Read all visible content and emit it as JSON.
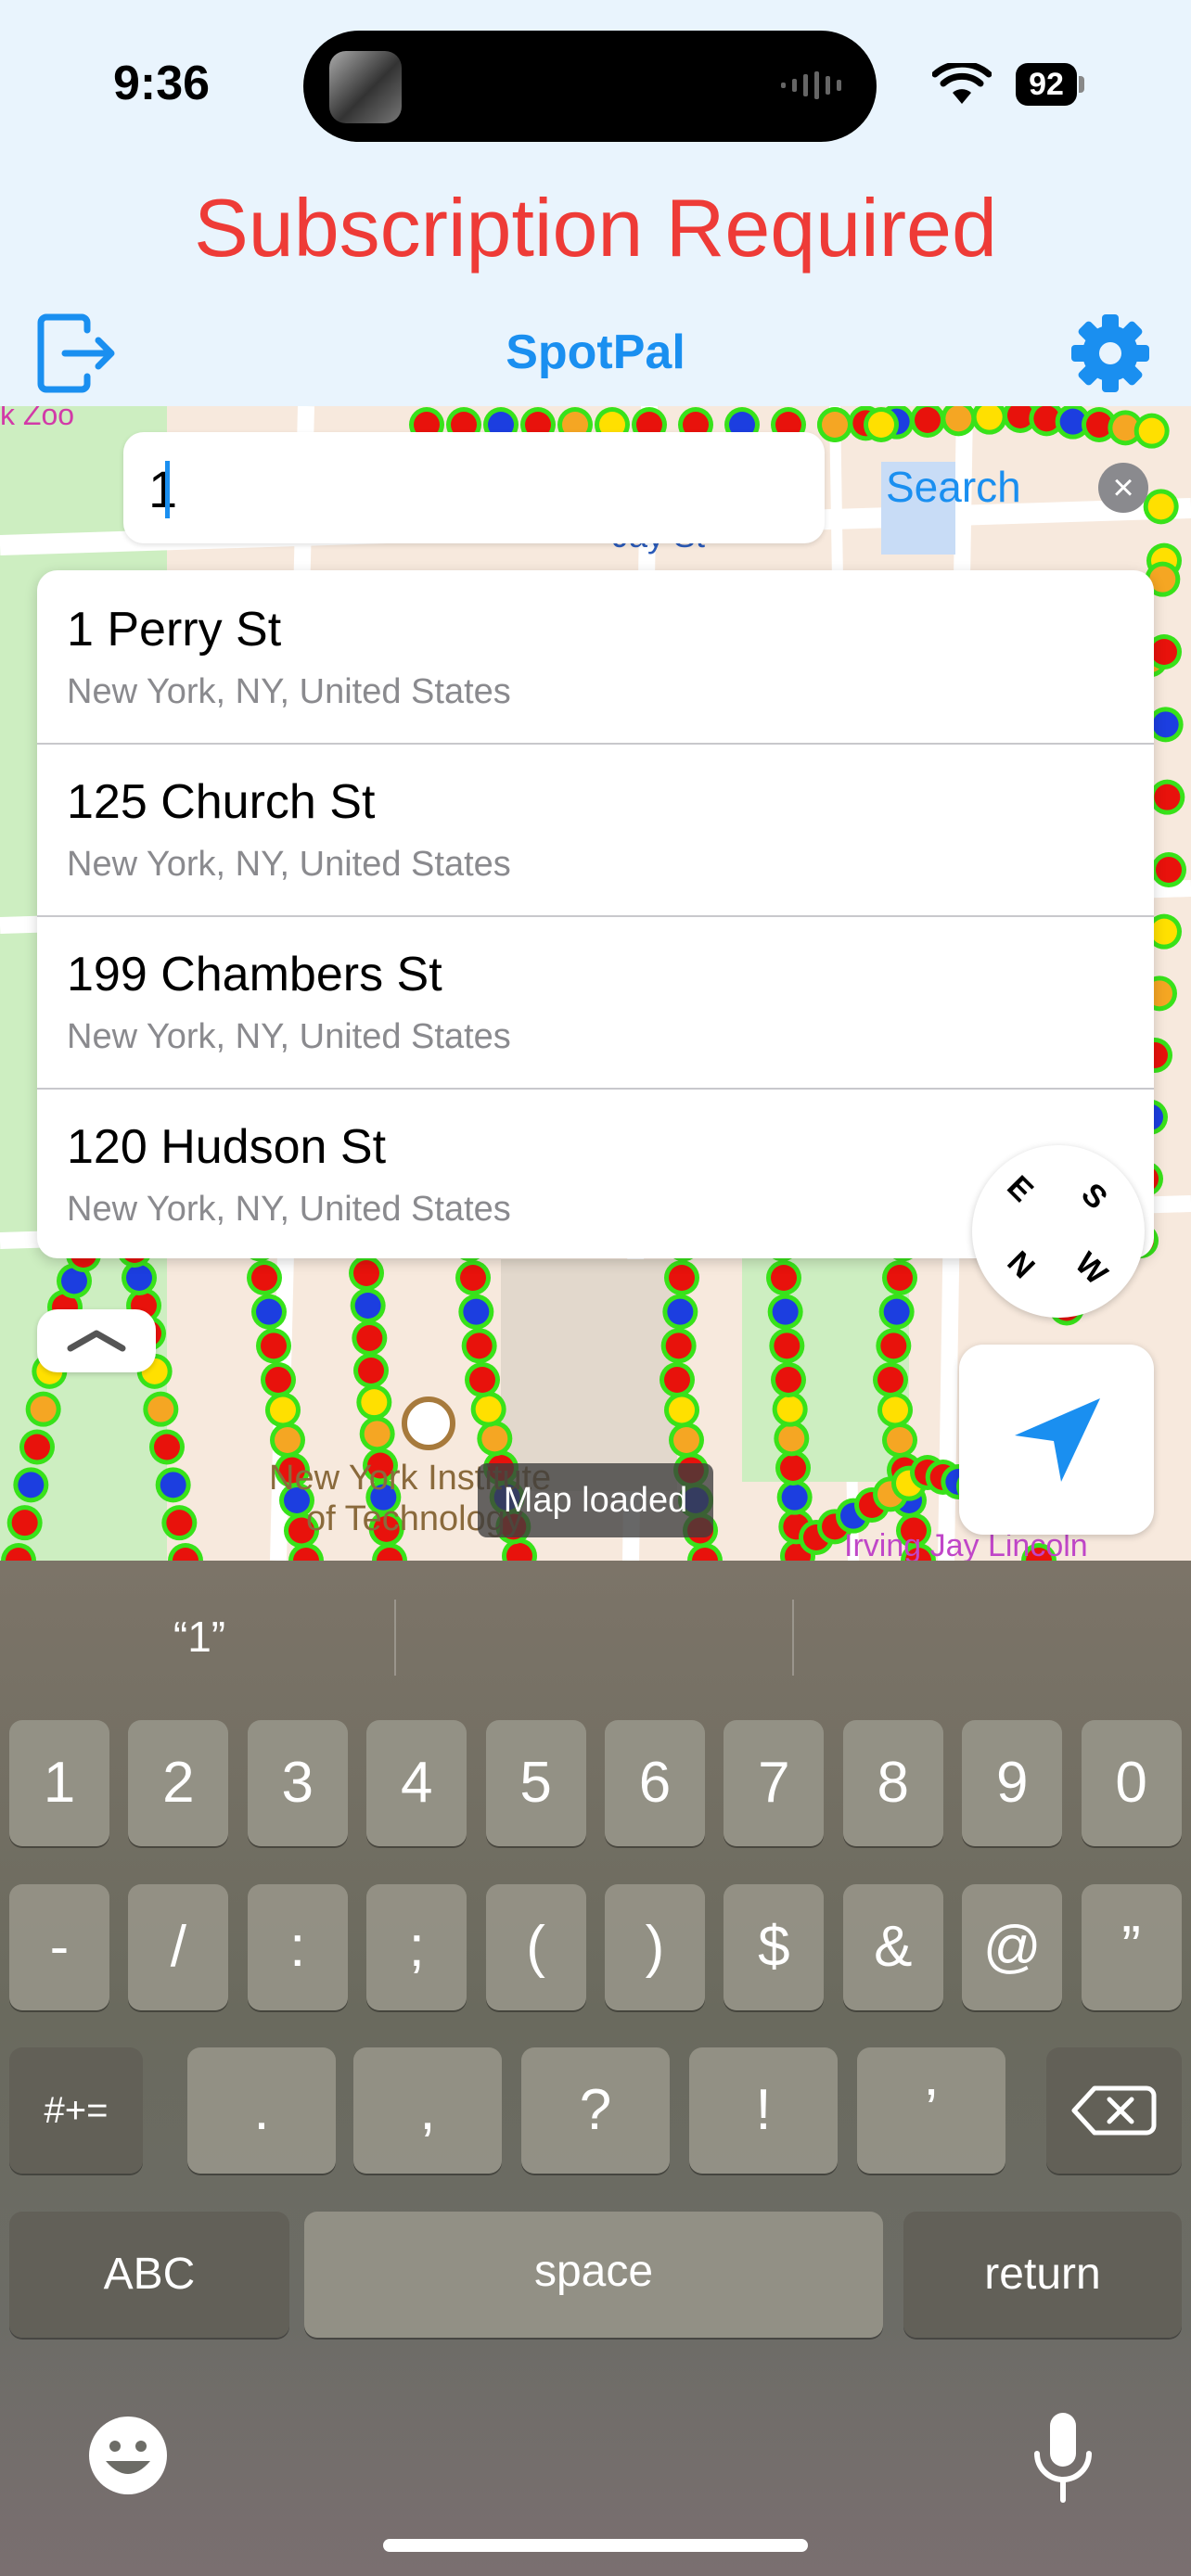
{
  "status": {
    "time": "9:36",
    "battery": "92"
  },
  "banner": {
    "text": "Subscription Required"
  },
  "nav": {
    "title": "SpotPal"
  },
  "search": {
    "value": "1",
    "button_label": "Search",
    "clear_label": "×"
  },
  "suggestions": [
    {
      "title": "1 Perry St",
      "subtitle": "New York, NY, United States"
    },
    {
      "title": "125 Church St",
      "subtitle": "New York, NY, United States"
    },
    {
      "title": "199 Chambers St",
      "subtitle": "New York, NY, United States"
    },
    {
      "title": "120 Hudson St",
      "subtitle": "New York, NY, United States"
    }
  ],
  "map": {
    "labels": {
      "zoo": "k Zoo",
      "institute_1": "New York Institute",
      "institute_2": "of Technology",
      "street": "Jay St",
      "lower": "Irving Jay Lincoln"
    },
    "compass": {
      "n": "N",
      "e": "E",
      "s": "S",
      "w": "W"
    },
    "toast": "Map loaded",
    "marker_colors": {
      "occupied": "#e8120c",
      "available": "#1c3ee0",
      "ring": "#38e21a",
      "warning": "#f5a623",
      "yellow": "#ffe000"
    }
  },
  "keyboard": {
    "prediction": "“1”",
    "row1": [
      "1",
      "2",
      "3",
      "4",
      "5",
      "6",
      "7",
      "8",
      "9",
      "0"
    ],
    "row2": [
      "-",
      "/",
      ":",
      ";",
      "(",
      ")",
      "$",
      "&",
      "@",
      "”"
    ],
    "row3": {
      "symbols": "#+=",
      "keys": [
        ".",
        ",",
        "?",
        "!",
        "’"
      ]
    },
    "row4": {
      "abc": "ABC",
      "space": "space",
      "return": "return"
    }
  }
}
